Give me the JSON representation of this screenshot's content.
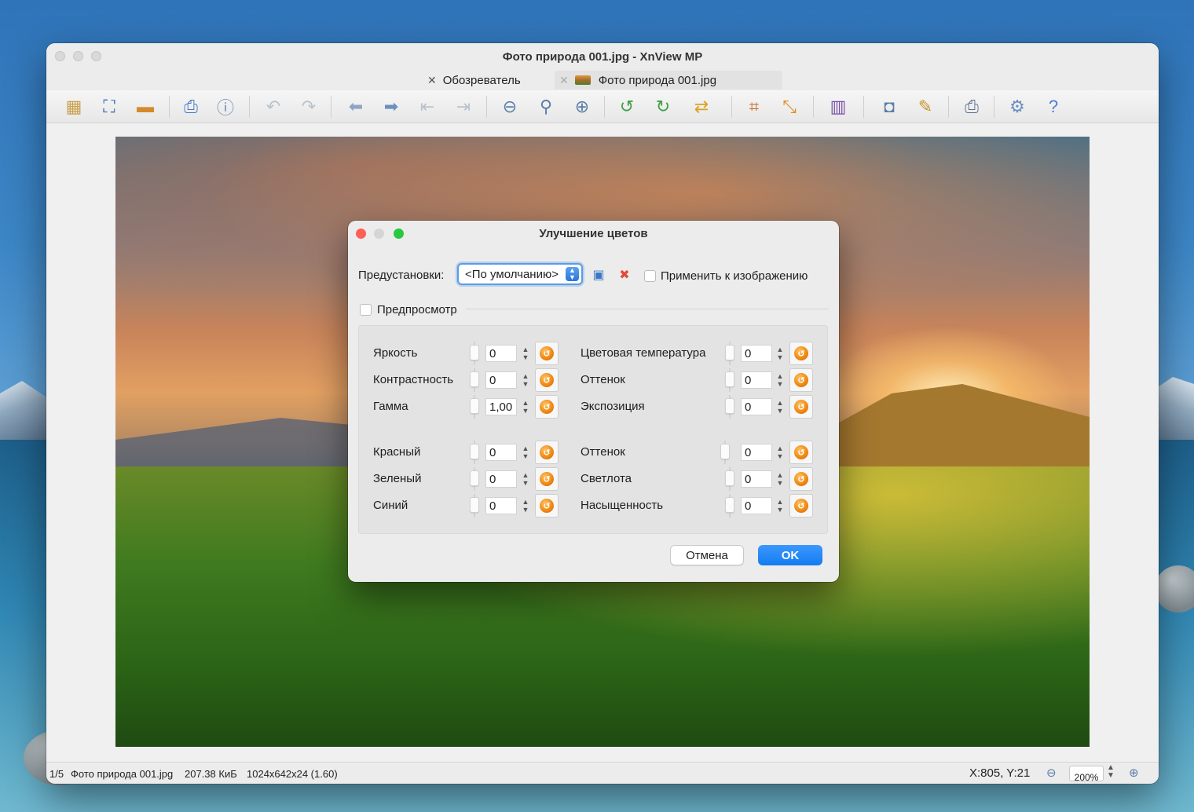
{
  "window": {
    "title": "Фото природа 001.jpg - XnView MP",
    "tabs": [
      {
        "label": "Обозреватель",
        "close": "✕"
      },
      {
        "label": "Фото природа 001.jpg",
        "close": "✕"
      }
    ]
  },
  "toolbar": {
    "icons": [
      "browser-icon",
      "fullscreen-icon",
      "slideshow-icon",
      "save-icon",
      "properties-icon",
      "undo-icon",
      "redo-icon",
      "previous-icon",
      "next-icon",
      "first-icon",
      "last-icon",
      "zoom-out-icon",
      "zoom-1-1-icon",
      "zoom-in-icon",
      "rotate-left-icon",
      "rotate-right-icon",
      "transform-icon",
      "crop-icon",
      "resize-icon",
      "adjust-colors-icon",
      "capture-icon",
      "edit-icon",
      "print-icon",
      "settings-icon",
      "help-icon"
    ]
  },
  "dialog": {
    "title": "Улучшение цветов",
    "presets_label": "Предустановки:",
    "preset_value": "<По умолчанию>",
    "apply_label": "Применить к изображению",
    "preview_label": "Предпросмотр",
    "left": [
      {
        "label": "Яркость",
        "value": "0"
      },
      {
        "label": "Контрастность",
        "value": "0"
      },
      {
        "label": "Гамма",
        "value": "1,00"
      },
      {
        "label": "Красный",
        "value": "0"
      },
      {
        "label": "Зеленый",
        "value": "0"
      },
      {
        "label": "Синий",
        "value": "0"
      }
    ],
    "right": [
      {
        "label": "Цветовая температура",
        "value": "0"
      },
      {
        "label": "Оттенок",
        "value": "0"
      },
      {
        "label": "Экспозиция",
        "value": "0"
      },
      {
        "label": "Оттенок",
        "value": "0"
      },
      {
        "label": "Светлота",
        "value": "0"
      },
      {
        "label": "Насыщенность",
        "value": "0"
      }
    ],
    "cancel": "Отмена",
    "ok": "OK"
  },
  "status": {
    "index": "1/5",
    "filename": "Фото природа 001.jpg",
    "filesize": "207.38 КиБ",
    "dimensions": "1024x642x24 (1.60)",
    "coords": "X:805, Y:21",
    "zoom": "200%"
  },
  "colors": {
    "accent": "#137cf0",
    "reset": "#f08a14",
    "close": "#fe5f57",
    "minimize": "#febc2e",
    "maximize": "#28c840"
  }
}
